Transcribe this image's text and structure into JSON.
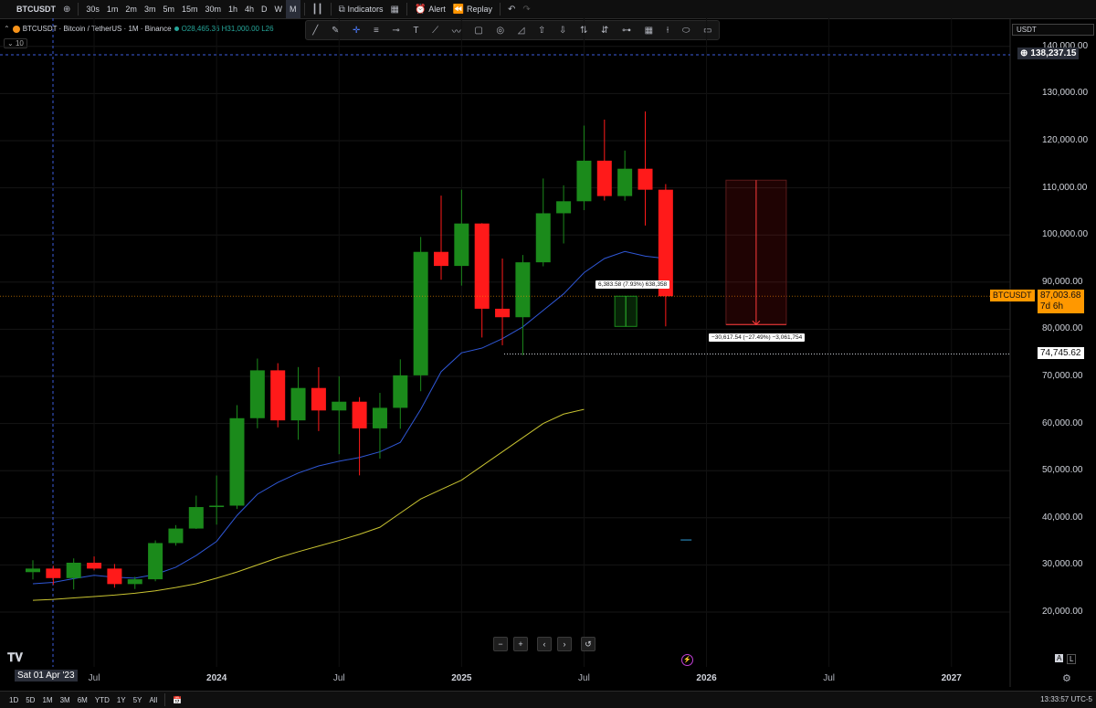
{
  "toolbar": {
    "symbol": "BTCUSDT",
    "intervals": [
      "30s",
      "1m",
      "2m",
      "3m",
      "5m",
      "15m",
      "30m",
      "1h",
      "4h",
      "D",
      "W",
      "M"
    ],
    "active_interval": "M",
    "indicators_label": "Indicators",
    "alert_label": "Alert",
    "replay_label": "Replay"
  },
  "legend": {
    "title": "BTCUSDT · Bitcoin / TetherUS · 1M · Binance",
    "ohlc": "O28,465.36 H31,000.00 L26"
  },
  "collapse_label": "10",
  "currency": "USDT",
  "price_axis": {
    "ticks": [
      "140,000.00",
      "130,000.00",
      "120,000.00",
      "110,000.00",
      "100,000.00",
      "90,000.00",
      "80,000.00",
      "70,000.00",
      "60,000.00",
      "50,000.00",
      "40,000.00",
      "30,000.00",
      "20,000.00"
    ],
    "crosshair_price": "138,237.15",
    "last_symbol": "BTCUSDT",
    "last_price": "87,003.68",
    "countdown": "7d 6h",
    "low_price": "74,745.62"
  },
  "time_axis": {
    "crosshair_date": "Sat 01 Apr '23",
    "ticks": [
      {
        "label": "Jul",
        "bold": false
      },
      {
        "label": "2024",
        "bold": true
      },
      {
        "label": "Jul",
        "bold": false
      },
      {
        "label": "2025",
        "bold": true
      },
      {
        "label": "Jul",
        "bold": false
      },
      {
        "label": "2026",
        "bold": true
      },
      {
        "label": "Jul",
        "bold": false
      },
      {
        "label": "2027",
        "bold": true
      }
    ]
  },
  "measure_up": "6,383.58 (7.93%) 638,358",
  "measure_down": "−30,617.54 (−27.49%) −3,061,754",
  "bottombar": {
    "ranges": [
      "1D",
      "5D",
      "1M",
      "3M",
      "6M",
      "YTD",
      "1Y",
      "5Y",
      "All"
    ],
    "clock": "13:33:57 UTC-5"
  },
  "colors": {
    "up": "#1b8a1b",
    "down": "#ff1a1a",
    "ma_fast": "#2f57d6",
    "ma_slow": "#c9c431",
    "background": "#000000"
  },
  "chart_data": {
    "type": "candlestick",
    "interval": "1M",
    "y_scale": "linear",
    "ylim": [
      16000,
      145000
    ],
    "candles": [
      {
        "t": "2023-04",
        "o": 28470,
        "h": 31000,
        "l": 26940,
        "c": 29230
      },
      {
        "t": "2023-05",
        "o": 29230,
        "h": 29820,
        "l": 25810,
        "c": 27210
      },
      {
        "t": "2023-06",
        "o": 27210,
        "h": 31390,
        "l": 24800,
        "c": 30470
      },
      {
        "t": "2023-07",
        "o": 30470,
        "h": 31800,
        "l": 28860,
        "c": 29230
      },
      {
        "t": "2023-08",
        "o": 29230,
        "h": 30200,
        "l": 25170,
        "c": 25940
      },
      {
        "t": "2023-09",
        "o": 25940,
        "h": 27480,
        "l": 24900,
        "c": 26960
      },
      {
        "t": "2023-10",
        "o": 26960,
        "h": 35200,
        "l": 26540,
        "c": 34640
      },
      {
        "t": "2023-11",
        "o": 34640,
        "h": 38450,
        "l": 34100,
        "c": 37720
      },
      {
        "t": "2023-12",
        "o": 37720,
        "h": 44700,
        "l": 37630,
        "c": 42280
      },
      {
        "t": "2024-01",
        "o": 42280,
        "h": 48970,
        "l": 38550,
        "c": 42580
      },
      {
        "t": "2024-02",
        "o": 42580,
        "h": 63900,
        "l": 41880,
        "c": 61130
      },
      {
        "t": "2024-03",
        "o": 61130,
        "h": 73780,
        "l": 59000,
        "c": 71280
      },
      {
        "t": "2024-04",
        "o": 71280,
        "h": 72800,
        "l": 59190,
        "c": 60670
      },
      {
        "t": "2024-05",
        "o": 60670,
        "h": 71980,
        "l": 56550,
        "c": 67540
      },
      {
        "t": "2024-06",
        "o": 67540,
        "h": 71950,
        "l": 58400,
        "c": 62770
      },
      {
        "t": "2024-07",
        "o": 62770,
        "h": 70020,
        "l": 53490,
        "c": 64630
      },
      {
        "t": "2024-08",
        "o": 64630,
        "h": 65600,
        "l": 49000,
        "c": 58970
      },
      {
        "t": "2024-09",
        "o": 58970,
        "h": 66500,
        "l": 52550,
        "c": 63330
      },
      {
        "t": "2024-10",
        "o": 63330,
        "h": 73620,
        "l": 58900,
        "c": 70220
      },
      {
        "t": "2024-11",
        "o": 70220,
        "h": 99590,
        "l": 66840,
        "c": 96410
      },
      {
        "t": "2024-12",
        "o": 96410,
        "h": 108350,
        "l": 90500,
        "c": 93430
      },
      {
        "t": "2025-01",
        "o": 93430,
        "h": 109590,
        "l": 89260,
        "c": 102430
      },
      {
        "t": "2025-02",
        "o": 102430,
        "h": 102500,
        "l": 78250,
        "c": 84350
      },
      {
        "t": "2025-03",
        "o": 84350,
        "h": 95000,
        "l": 76600,
        "c": 82550
      },
      {
        "t": "2025-04",
        "o": 82550,
        "h": 95750,
        "l": 74500,
        "c": 94200
      },
      {
        "t": "2025-05",
        "o": 94200,
        "h": 111980,
        "l": 93350,
        "c": 104600
      },
      {
        "t": "2025-06",
        "o": 104600,
        "h": 110530,
        "l": 98200,
        "c": 107150
      },
      {
        "t": "2025-07",
        "o": 107150,
        "h": 123200,
        "l": 105270,
        "c": 115760
      },
      {
        "t": "2025-08",
        "o": 115760,
        "h": 124470,
        "l": 107300,
        "c": 108250
      },
      {
        "t": "2025-09",
        "o": 108250,
        "h": 117900,
        "l": 107270,
        "c": 114050
      },
      {
        "t": "2025-10",
        "o": 114050,
        "h": 126200,
        "l": 102000,
        "c": 109600
      },
      {
        "t": "2025-11",
        "o": 109600,
        "h": 110800,
        "l": 80600,
        "c": 87003.68
      }
    ],
    "series": [
      {
        "values": [
          26000,
          26300,
          27100,
          27800,
          27400,
          27200,
          28000,
          29500,
          32000,
          35000,
          40500,
          45000,
          47500,
          49500,
          51000,
          52000,
          52800,
          54000,
          56000,
          63000,
          71000,
          75000,
          76000,
          78000,
          80500,
          84000,
          87500,
          92000,
          95000,
          96500,
          95500,
          95000
        ]
      },
      {
        "values": [
          22500,
          22700,
          23000,
          23300,
          23600,
          24000,
          24500,
          25200,
          26000,
          27200,
          28500,
          30000,
          31500,
          32800,
          34000,
          35200,
          36500,
          38000,
          41000,
          44000,
          46000,
          48000,
          51000,
          54000,
          57000,
          60000,
          62000,
          63000
        ]
      }
    ],
    "annotations": [
      {
        "type": "price_range",
        "from": 80600,
        "to": 87003.68,
        "label": "6,383.58 (7.93%) 638,358"
      },
      {
        "type": "price_range",
        "from": 111620,
        "to": 81000,
        "label": "−30,617.54 (−27.49%) −3,061,754"
      },
      {
        "type": "horizontal_line",
        "price": 74745.62
      },
      {
        "type": "horizontal_line",
        "price": 87003.68
      }
    ]
  }
}
